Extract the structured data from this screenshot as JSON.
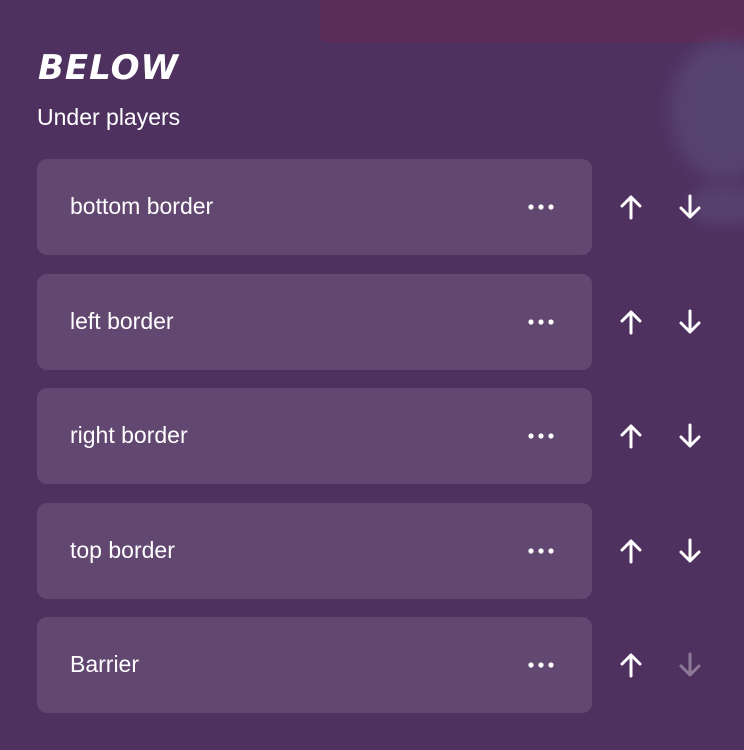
{
  "section": {
    "title": "BELOW",
    "subtitle": "Under players"
  },
  "layers": [
    {
      "name": "bottom border",
      "up_enabled": true,
      "down_enabled": true
    },
    {
      "name": "left border",
      "up_enabled": true,
      "down_enabled": true
    },
    {
      "name": "right border",
      "up_enabled": true,
      "down_enabled": true
    },
    {
      "name": "top border",
      "up_enabled": true,
      "down_enabled": true
    },
    {
      "name": "Barrier",
      "up_enabled": true,
      "down_enabled": false
    }
  ],
  "icons": {
    "more": "more-horizontal-icon",
    "up": "arrow-up-icon",
    "down": "arrow-down-icon"
  },
  "colors": {
    "background": "#4f3160",
    "card": "rgba(255,255,255,0.11)",
    "text": "#ffffff"
  }
}
